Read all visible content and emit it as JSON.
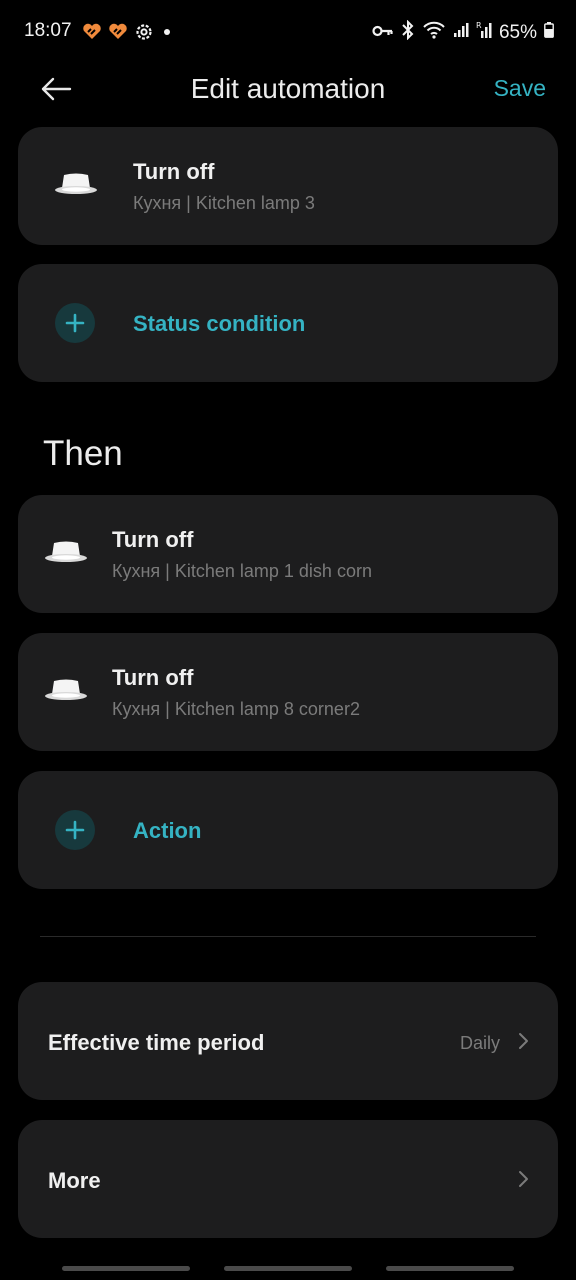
{
  "status_bar": {
    "time": "18:07",
    "battery": "65%",
    "icons": [
      "heart-sync-icon",
      "heart-sync-icon",
      "settings-gear-icon",
      "dot-icon",
      "key-icon",
      "bluetooth-icon",
      "wifi-icon",
      "signal-icon",
      "signal-roaming-icon",
      "battery-icon"
    ]
  },
  "header": {
    "title": "Edit automation",
    "save_label": "Save"
  },
  "if_conditions": [
    {
      "action": "Turn off",
      "device": "Кухня | Kitchen lamp 3"
    }
  ],
  "add_condition_label": "Status condition",
  "then_title": "Then",
  "then_actions": [
    {
      "action": "Turn off",
      "device": "Кухня | Kitchen lamp 1 dish corn"
    },
    {
      "action": "Turn off",
      "device": "Кухня | Kitchen lamp 8 corner2"
    }
  ],
  "add_action_label": "Action",
  "settings": {
    "time_period": {
      "label": "Effective time period",
      "value": "Daily"
    },
    "more": {
      "label": "More"
    }
  },
  "colors": {
    "accent": "#35b3c3",
    "card": "#1d1d1e",
    "background": "#000000",
    "secondary_text": "#7b7b7b"
  }
}
